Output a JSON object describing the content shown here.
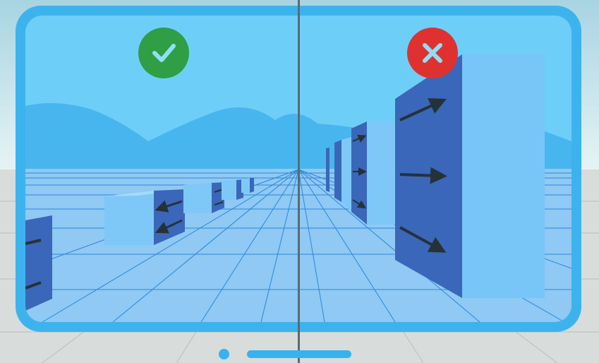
{
  "comparison": {
    "left_panel": {
      "verdict": "correct",
      "icon": "checkmark-icon",
      "color": "#2f9e44"
    },
    "right_panel": {
      "verdict": "incorrect",
      "icon": "close-icon",
      "color": "#e03131"
    }
  },
  "pager": {
    "indicator_color": "#38b2ec"
  },
  "colors": {
    "frame": "#3db3ee",
    "sky": "#6dcff8",
    "mountains": "#48b6ee",
    "floor": "#8fc9f4",
    "grid_lines": "#2e86d8",
    "box_dark": "#3a67b9",
    "box_light": "#7ec8f7",
    "arrow": "#263238"
  }
}
